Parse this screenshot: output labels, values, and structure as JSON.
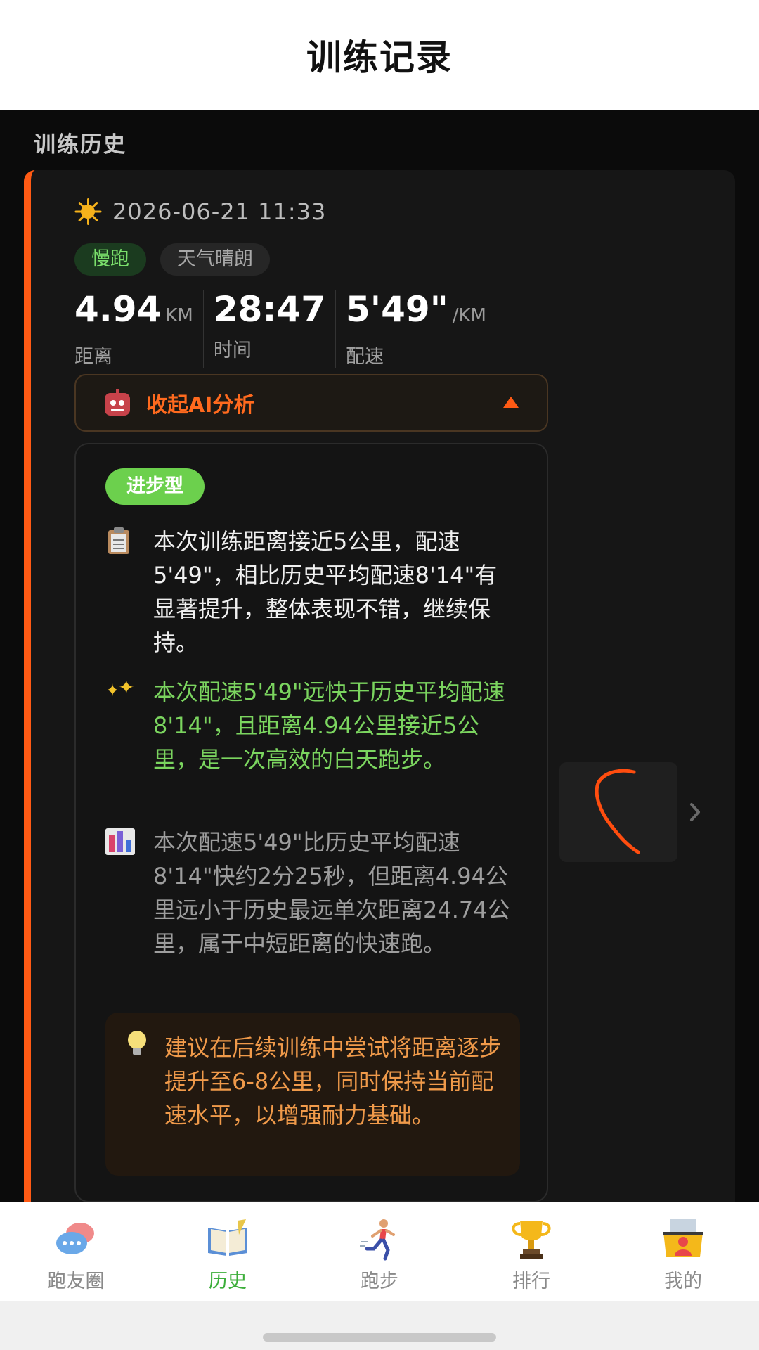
{
  "header": {
    "title": "训练记录"
  },
  "section": {
    "title": "训练历史"
  },
  "record": {
    "datetime": "2026-06-21 11:33",
    "type_tag": "慢跑",
    "weather_tag": "天气晴朗",
    "stats": {
      "distance": {
        "value": "4.94",
        "unit": "KM",
        "label": "距离"
      },
      "duration": {
        "value": "28:47",
        "label": "时间"
      },
      "pace": {
        "value": "5'49\"",
        "unit": "/KM",
        "label": "配速"
      }
    },
    "ai_toggle_label": "收起AI分析",
    "ai": {
      "badge": "进步型",
      "summary": "本次训练距离接近5公里，配速5'49\"，相比历史平均配速8'14\"有显著提升，整体表现不错，继续保持。",
      "highlight": "本次配速5'49\"远快于历史平均配速8'14\"，且距离4.94公里接近5公里，是一次高效的白天跑步。",
      "comparison": "本次配速5'49\"比历史平均配速8'14\"快约2分25秒，但距离4.94公里远小于历史最远单次距离24.74公里，属于中短距离的快速跑。",
      "tip": "建议在后续训练中尝试将距离逐步提升至6-8公里，同时保持当前配速水平，以增强耐力基础。"
    }
  },
  "tabs": [
    {
      "label": "跑友圈",
      "icon": "chat-bubbles-icon"
    },
    {
      "label": "历史",
      "icon": "book-icon",
      "active": true
    },
    {
      "label": "跑步",
      "icon": "runner-icon"
    },
    {
      "label": "排行",
      "icon": "trophy-icon"
    },
    {
      "label": "我的",
      "icon": "profile-card-icon"
    }
  ],
  "colors": {
    "accent": "#ff5a14",
    "active_tab": "#3cae3a",
    "insight_green": "#7bd55f",
    "tip_orange": "#f09a4a"
  }
}
